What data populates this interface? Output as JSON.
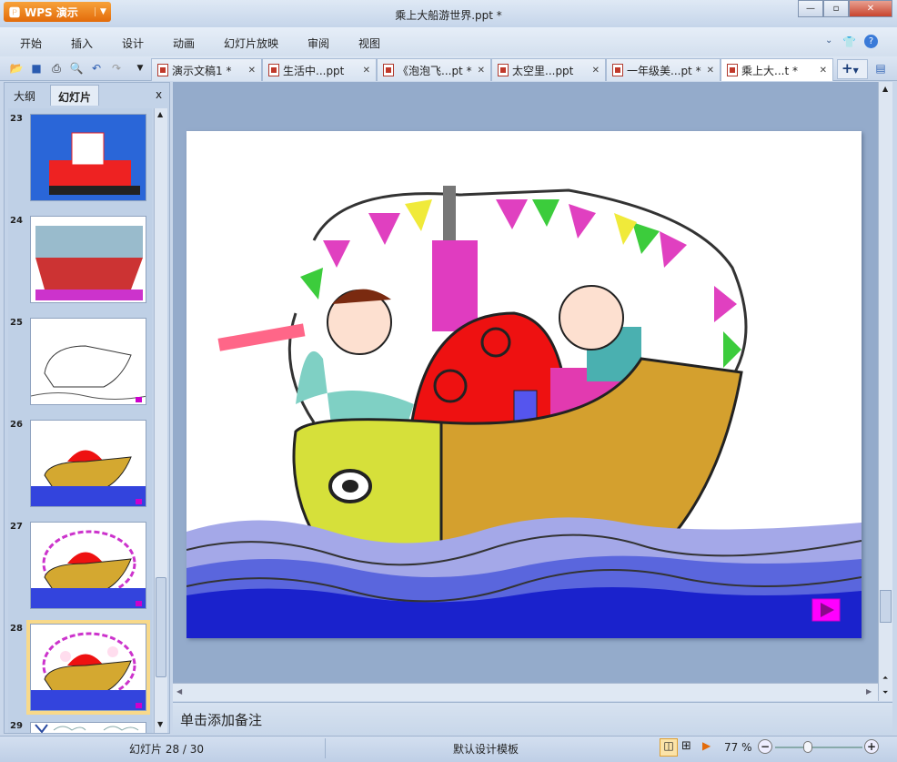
{
  "app": {
    "button_label": "WPS 演示",
    "window_title": "乘上大船游世界.ppt *"
  },
  "menu": [
    "开始",
    "插入",
    "设计",
    "动画",
    "幻灯片放映",
    "审阅",
    "视图"
  ],
  "tabs": [
    {
      "label": "演示文稿1 *"
    },
    {
      "label": "生活中...ppt"
    },
    {
      "label": "《泡泡飞...pt *"
    },
    {
      "label": "太空里...ppt"
    },
    {
      "label": "一年级美...pt *"
    },
    {
      "label": "乘上大...t *",
      "active": true
    }
  ],
  "panel": {
    "tabs": [
      "大纲",
      "幻灯片"
    ],
    "close": "x"
  },
  "thumbnails": [
    {
      "num": "23"
    },
    {
      "num": "24"
    },
    {
      "num": "25"
    },
    {
      "num": "26"
    },
    {
      "num": "27"
    },
    {
      "num": "28",
      "selected": true
    },
    {
      "num": "29"
    }
  ],
  "notes": {
    "placeholder": "单击添加备注"
  },
  "status": {
    "slide": "幻灯片 28 / 30",
    "template": "默认设计模板",
    "zoom": "77 %",
    "zoom_percent": 77
  },
  "colors": {
    "accent": "#e36b0a",
    "workspace": "#94abcb"
  }
}
